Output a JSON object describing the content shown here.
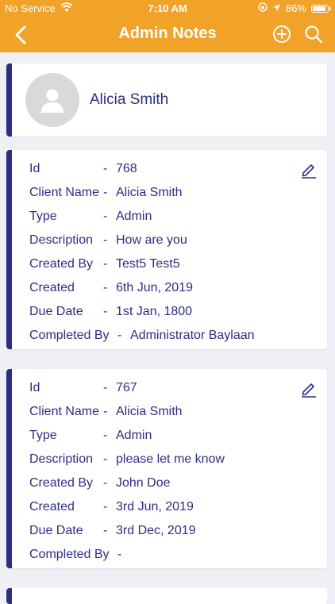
{
  "status_bar": {
    "carrier": "No Service",
    "time": "7:10 AM",
    "battery": "86%"
  },
  "header": {
    "title": "Admin Notes"
  },
  "profile": {
    "name": "Alicia Smith"
  },
  "notes": [
    {
      "id": {
        "label": "Id",
        "value": "768"
      },
      "client": {
        "label": "Client Name",
        "value": "Alicia Smith"
      },
      "type": {
        "label": "Type",
        "value": "Admin"
      },
      "description": {
        "label": "Description",
        "value": "How are you"
      },
      "created_by": {
        "label": "Created By",
        "value": "Test5 Test5"
      },
      "created": {
        "label": "Created",
        "value": "6th Jun, 2019"
      },
      "due_date": {
        "label": "Due Date",
        "value": "1st Jan, 1800"
      },
      "completed_by": {
        "label": "Completed By",
        "value": "Administrator Baylaan"
      }
    },
    {
      "id": {
        "label": "Id",
        "value": "767"
      },
      "client": {
        "label": "Client Name",
        "value": "Alicia Smith"
      },
      "type": {
        "label": "Type",
        "value": "Admin"
      },
      "description": {
        "label": "Description",
        "value": "please let me know"
      },
      "created_by": {
        "label": "Created By",
        "value": "John Doe"
      },
      "created": {
        "label": "Created",
        "value": "3rd Jun, 2019"
      },
      "due_date": {
        "label": "Due Date",
        "value": "3rd Dec, 2019"
      },
      "completed_by": {
        "label": "Completed By",
        "value": ""
      }
    }
  ],
  "separator": "-",
  "colors": {
    "header": "#f0a229",
    "accent": "#2c2e83",
    "background": "#eef0f5"
  },
  "icons": {
    "back": "chevron-left-icon",
    "add": "plus-circle-icon",
    "search": "search-icon",
    "edit": "pencil-icon",
    "avatar": "person-placeholder-icon"
  }
}
